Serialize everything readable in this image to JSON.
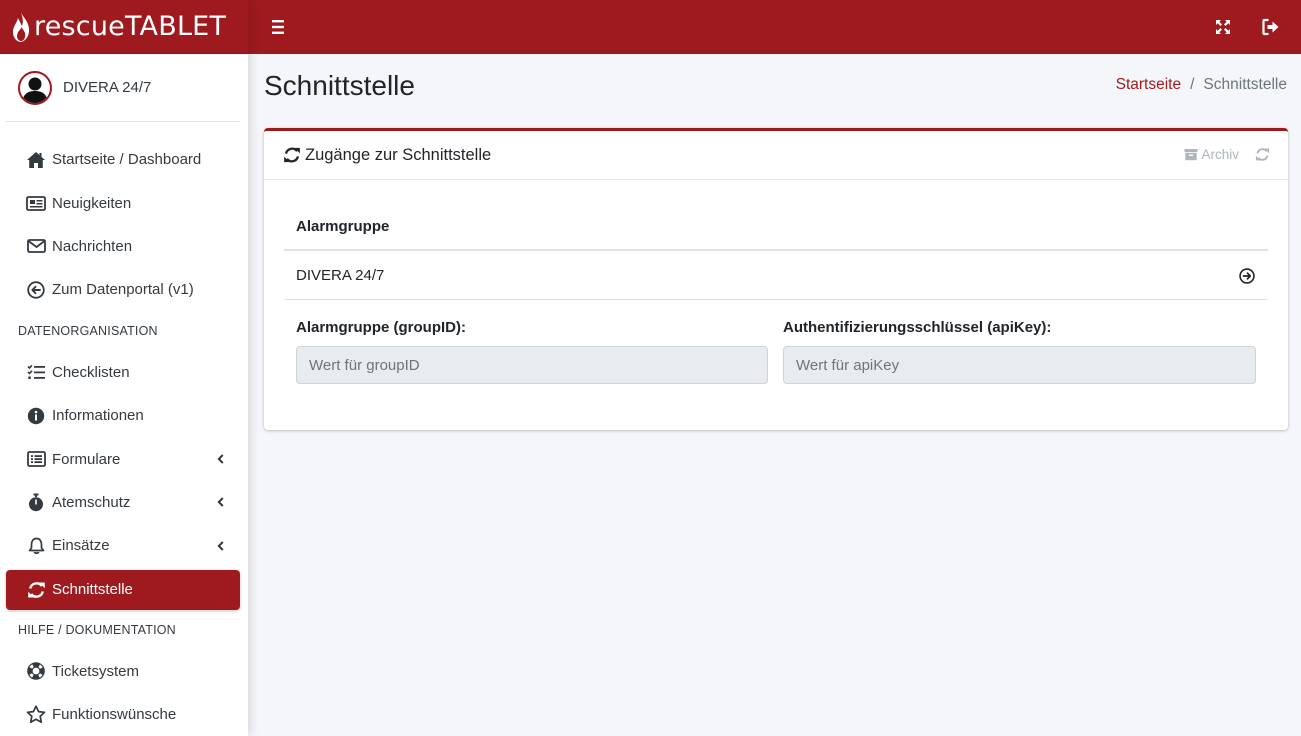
{
  "brand": {
    "name": "rescueTABLET"
  },
  "user": {
    "name": "DIVERA 24/7"
  },
  "sidebar": {
    "items": [
      {
        "label": "Startseite / Dashboard"
      },
      {
        "label": "Neuigkeiten"
      },
      {
        "label": "Nachrichten"
      },
      {
        "label": "Zum Datenportal (v1)"
      }
    ],
    "section_daten": "DATENORGANISATION",
    "daten_items": [
      {
        "label": "Checklisten"
      },
      {
        "label": "Informationen"
      },
      {
        "label": "Formulare"
      },
      {
        "label": "Atemschutz"
      },
      {
        "label": "Einsätze"
      },
      {
        "label": "Schnittstelle"
      }
    ],
    "section_hilfe": "HILFE / DOKUMENTATION",
    "hilfe_items": [
      {
        "label": "Ticketsystem"
      },
      {
        "label": "Funktionswünsche"
      }
    ]
  },
  "page": {
    "title": "Schnittstelle",
    "breadcrumb": {
      "home": "Startseite",
      "separator": "/",
      "current": "Schnittstelle"
    }
  },
  "card": {
    "title": "Zugänge zur Schnittstelle",
    "archiv_label": "Archiv",
    "table": {
      "header": "Alarmgruppe",
      "rows": [
        {
          "name": "DIVERA 24/7"
        }
      ]
    },
    "form": {
      "group_label": "Alarmgruppe (groupID):",
      "group_placeholder": "Wert für groupID",
      "api_label": "Authentifizierungsschlüssel (apiKey):",
      "api_placeholder": "Wert für apiKey"
    }
  },
  "colors": {
    "brand": "#9e1a1e",
    "background": "#f4f6f9",
    "muted": "#adb5bd"
  },
  "icons": {
    "topbar": [
      "bars-icon",
      "expand-icon",
      "logout-icon"
    ],
    "sidebar": [
      "home-icon",
      "newspaper-icon",
      "envelope-icon",
      "arrow-circle-left-icon",
      "list-check-icon",
      "info-circle-icon",
      "list-alt-icon",
      "stopwatch-icon",
      "bell-icon",
      "sync-icon",
      "life-ring-icon",
      "star-icon"
    ]
  }
}
